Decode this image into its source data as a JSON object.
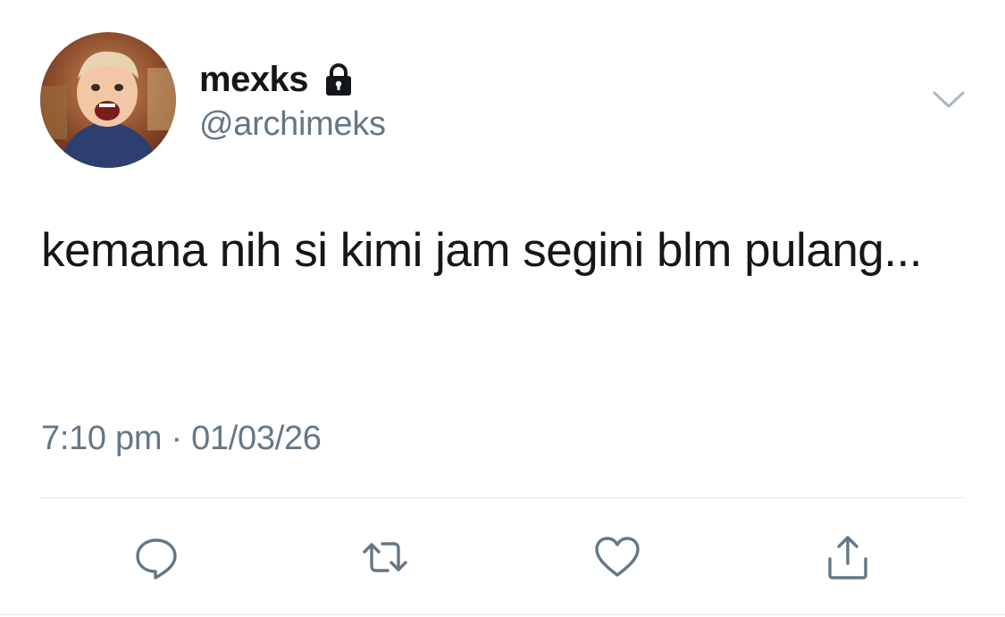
{
  "user": {
    "display_name": "mexks",
    "handle": "@archimeks",
    "protected_icon": "lock-icon",
    "avatar": "profile-avatar"
  },
  "tweet": {
    "text": "kemana nih si kimi jam segini blm pulang...",
    "time": "7:10 pm",
    "separator": "·",
    "date": "01/03/26"
  },
  "menu": {
    "icon": "chevron-down-icon"
  },
  "actions": [
    {
      "name": "reply",
      "icon": "reply-icon"
    },
    {
      "name": "retweet",
      "icon": "retweet-icon"
    },
    {
      "name": "like",
      "icon": "heart-icon"
    },
    {
      "name": "share",
      "icon": "share-icon"
    }
  ],
  "colors": {
    "text_primary": "#14171a",
    "text_secondary": "#657786",
    "icon_gray": "#657786",
    "divider": "#e1e8ed"
  }
}
